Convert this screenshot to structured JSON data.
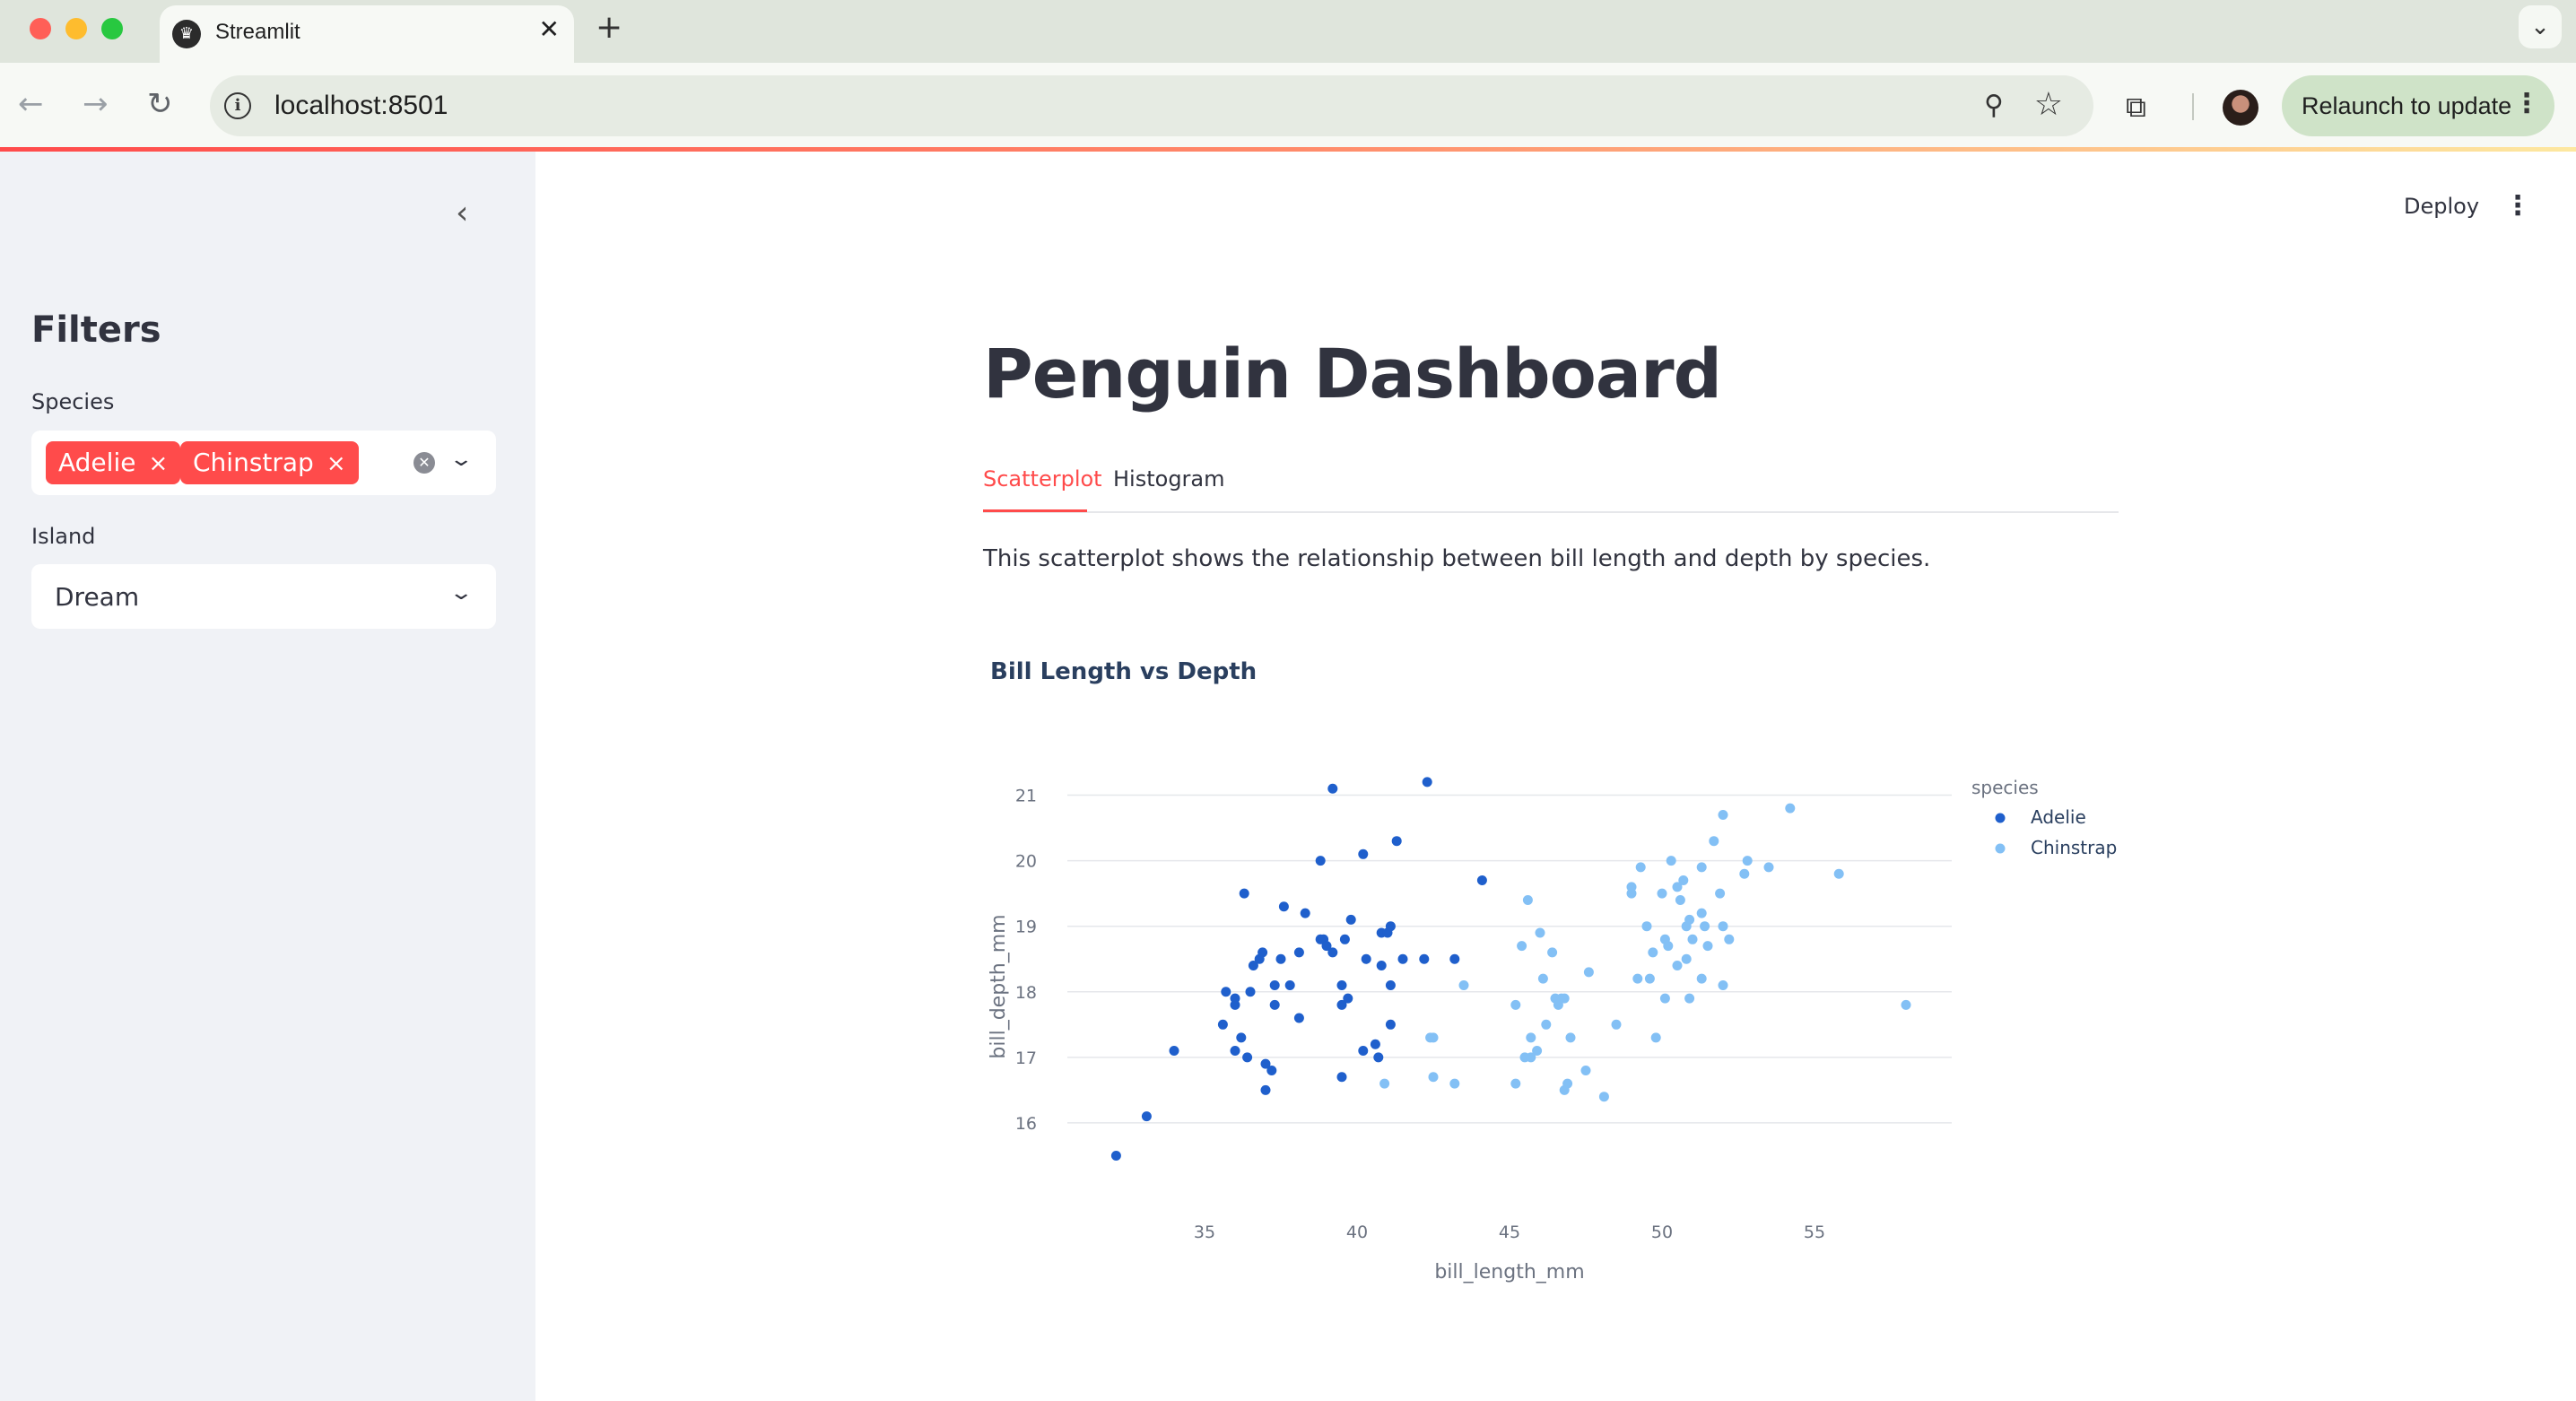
{
  "browser": {
    "tab_title": "Streamlit",
    "url": "localhost:8501",
    "relaunch_label": "Relaunch to update"
  },
  "sidebar": {
    "title": "Filters",
    "species_label": "Species",
    "species_selected": [
      "Adelie",
      "Chinstrap"
    ],
    "island_label": "Island",
    "island_value": "Dream"
  },
  "header": {
    "deploy_label": "Deploy"
  },
  "main": {
    "title": "Penguin Dashboard",
    "tabs": [
      {
        "label": "Scatterplot",
        "active": true
      },
      {
        "label": "Histogram",
        "active": false
      }
    ],
    "description": "This scatterplot shows the relationship between bill length and depth by species."
  },
  "colors": {
    "accent": "#ff4b4b",
    "adelie": "#1f5fcc",
    "chinstrap": "#83c0f5"
  },
  "chart_data": {
    "type": "scatter",
    "title": "Bill Length vs Depth",
    "xlabel": "bill_length_mm",
    "ylabel": "bill_depth_mm",
    "xlim": [
      30.5,
      59.5
    ],
    "ylim": [
      15.0,
      21.5
    ],
    "xticks": [
      35,
      40,
      45,
      50,
      55
    ],
    "yticks": [
      16,
      17,
      18,
      19,
      20,
      21
    ],
    "legend_title": "species",
    "legend_position": "top-right",
    "grid": true,
    "series": [
      {
        "name": "Adelie",
        "color": "#1f5fcc",
        "points": [
          [
            32.1,
            15.5
          ],
          [
            33.1,
            16.1
          ],
          [
            34.0,
            17.1
          ],
          [
            35.7,
            18.0
          ],
          [
            35.6,
            17.5
          ],
          [
            36.0,
            17.1
          ],
          [
            36.3,
            19.5
          ],
          [
            36.5,
            18.0
          ],
          [
            36.4,
            17.0
          ],
          [
            36.6,
            18.4
          ],
          [
            36.8,
            18.5
          ],
          [
            36.9,
            18.6
          ],
          [
            36.2,
            17.3
          ],
          [
            36.0,
            17.8
          ],
          [
            36.0,
            17.9
          ],
          [
            37.0,
            16.9
          ],
          [
            37.3,
            17.8
          ],
          [
            37.3,
            18.1
          ],
          [
            37.5,
            18.5
          ],
          [
            37.6,
            19.3
          ],
          [
            37.2,
            16.8
          ],
          [
            37.0,
            16.5
          ],
          [
            37.8,
            18.1
          ],
          [
            38.1,
            18.6
          ],
          [
            38.1,
            17.6
          ],
          [
            38.3,
            19.2
          ],
          [
            38.8,
            18.8
          ],
          [
            38.9,
            18.8
          ],
          [
            39.0,
            18.7
          ],
          [
            39.2,
            18.6
          ],
          [
            38.8,
            20.0
          ],
          [
            39.2,
            21.1
          ],
          [
            39.5,
            18.1
          ],
          [
            39.6,
            18.8
          ],
          [
            39.5,
            17.8
          ],
          [
            39.7,
            17.9
          ],
          [
            39.8,
            19.1
          ],
          [
            39.5,
            16.7
          ],
          [
            40.2,
            20.1
          ],
          [
            40.3,
            18.5
          ],
          [
            40.2,
            17.1
          ],
          [
            40.6,
            17.2
          ],
          [
            40.7,
            17.0
          ],
          [
            40.8,
            18.4
          ],
          [
            40.8,
            18.9
          ],
          [
            41.0,
            18.9
          ],
          [
            41.1,
            19.0
          ],
          [
            41.1,
            18.1
          ],
          [
            41.1,
            17.5
          ],
          [
            41.3,
            20.3
          ],
          [
            41.5,
            18.5
          ],
          [
            42.2,
            18.5
          ],
          [
            42.3,
            21.2
          ],
          [
            43.2,
            18.5
          ],
          [
            44.1,
            19.7
          ]
        ]
      },
      {
        "name": "Chinstrap",
        "color": "#83c0f5",
        "points": [
          [
            40.9,
            16.6
          ],
          [
            42.4,
            17.3
          ],
          [
            42.5,
            17.3
          ],
          [
            42.5,
            16.7
          ],
          [
            43.2,
            16.6
          ],
          [
            43.5,
            18.1
          ],
          [
            45.2,
            17.8
          ],
          [
            45.2,
            16.6
          ],
          [
            45.4,
            18.7
          ],
          [
            45.5,
            17.0
          ],
          [
            45.6,
            19.4
          ],
          [
            45.7,
            17.0
          ],
          [
            45.7,
            17.3
          ],
          [
            45.9,
            17.1
          ],
          [
            46.0,
            18.9
          ],
          [
            46.1,
            18.2
          ],
          [
            46.2,
            17.5
          ],
          [
            46.4,
            18.6
          ],
          [
            46.5,
            17.9
          ],
          [
            46.6,
            17.8
          ],
          [
            46.7,
            17.9
          ],
          [
            46.8,
            16.5
          ],
          [
            46.8,
            17.9
          ],
          [
            46.9,
            16.6
          ],
          [
            47.0,
            17.3
          ],
          [
            47.5,
            16.8
          ],
          [
            47.6,
            18.3
          ],
          [
            48.1,
            16.4
          ],
          [
            48.5,
            17.5
          ],
          [
            49.0,
            19.5
          ],
          [
            49.0,
            19.6
          ],
          [
            49.2,
            18.2
          ],
          [
            49.3,
            19.9
          ],
          [
            49.5,
            19.0
          ],
          [
            49.6,
            18.2
          ],
          [
            49.7,
            18.6
          ],
          [
            49.8,
            17.3
          ],
          [
            50.0,
            19.5
          ],
          [
            50.1,
            17.9
          ],
          [
            50.1,
            18.8
          ],
          [
            50.2,
            18.7
          ],
          [
            50.3,
            20.0
          ],
          [
            50.5,
            18.4
          ],
          [
            50.5,
            19.6
          ],
          [
            50.6,
            19.4
          ],
          [
            50.7,
            19.7
          ],
          [
            50.8,
            18.5
          ],
          [
            50.8,
            19.0
          ],
          [
            50.9,
            17.9
          ],
          [
            50.9,
            19.1
          ],
          [
            51.0,
            18.8
          ],
          [
            51.3,
            19.2
          ],
          [
            51.3,
            18.2
          ],
          [
            51.3,
            19.9
          ],
          [
            51.4,
            19.0
          ],
          [
            51.5,
            18.7
          ],
          [
            51.7,
            20.3
          ],
          [
            51.9,
            19.5
          ],
          [
            52.0,
            18.1
          ],
          [
            52.0,
            19.0
          ],
          [
            52.0,
            20.7
          ],
          [
            52.2,
            18.8
          ],
          [
            52.7,
            19.8
          ],
          [
            52.8,
            20.0
          ],
          [
            53.5,
            19.9
          ],
          [
            54.2,
            20.8
          ],
          [
            55.8,
            19.8
          ],
          [
            58.0,
            17.8
          ]
        ]
      }
    ]
  }
}
